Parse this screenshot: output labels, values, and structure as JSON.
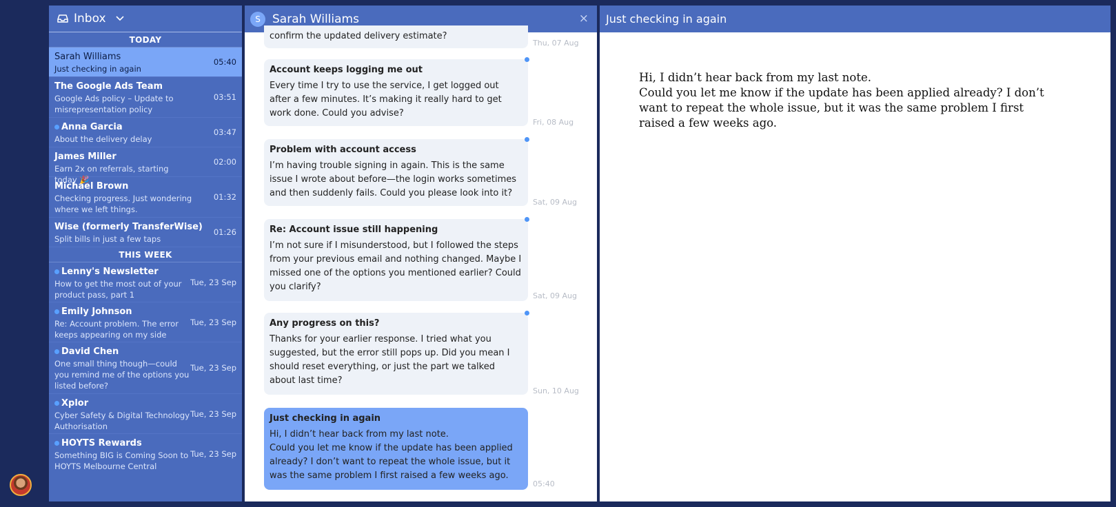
{
  "inbox": {
    "title": "Inbox",
    "sections": {
      "today": "TODAY",
      "this_week": "THIS WEEK"
    },
    "today": [
      {
        "from": "Sarah Williams",
        "preview": "Just checking in again",
        "time": "05:40",
        "unread": false,
        "selected": true
      },
      {
        "from": "The Google Ads Team",
        "preview": "Google Ads policy – Update to misrepresentation policy",
        "time": "03:51",
        "unread": false
      },
      {
        "from": "Anna Garcia",
        "preview": "About the delivery delay",
        "time": "03:47",
        "unread": true
      },
      {
        "from": "James Miller",
        "preview": "Earn 2x on referrals, starting today 🎉",
        "time": "02:00",
        "unread": false
      },
      {
        "from": "Michael Brown",
        "preview": "Checking progress. Just wondering where we left things.",
        "time": "01:32",
        "unread": false
      },
      {
        "from": "Wise (formerly TransferWise)",
        "preview": "Split bills in just a few taps",
        "time": "01:26",
        "unread": false
      }
    ],
    "this_week": [
      {
        "from": "Lenny's Newsletter",
        "preview": "How to get the most out of your product pass, part 1",
        "time": "Tue, 23 Sep",
        "unread": true
      },
      {
        "from": "Emily Johnson",
        "preview": "Re: Account problem. The error keeps appearing on my side",
        "time": "Tue, 23 Sep",
        "unread": true
      },
      {
        "from": "David Chen",
        "preview": "One small thing though—could you remind me of the options you listed before?",
        "time": "Tue, 23 Sep",
        "unread": true
      },
      {
        "from": "Xplor",
        "preview": "Cyber Safety & Digital Technology Authorisation",
        "time": "Tue, 23 Sep",
        "unread": true
      },
      {
        "from": "HOYTS Rewards",
        "preview": "Something BIG is Coming Soon to HOYTS Melbourne Central",
        "time": "Tue, 23 Sep",
        "unread": true
      }
    ]
  },
  "conversation": {
    "avatar_initial": "S",
    "name": "Sarah Williams",
    "close_glyph": "×",
    "partial_message": {
      "body": "confirm the updated delivery estimate?",
      "stamp": "Thu, 07 Aug"
    },
    "messages": [
      {
        "subject": "Account keeps logging me out",
        "body": "Every time I try to use the service, I get logged out after a few minutes. It’s making it really hard to get work done. Could you advise?",
        "stamp": "Fri, 08 Aug"
      },
      {
        "subject": "Problem with account access",
        "body": "I’m having trouble signing in again. This is the same issue I wrote about before—the login works sometimes and then suddenly fails. Could you please look into it?",
        "stamp": "Sat, 09 Aug"
      },
      {
        "subject": "Re: Account issue still happening",
        "body": "I’m not sure if I misunderstood, but I followed the steps from your previous email and nothing changed. Maybe I missed one of the options you mentioned earlier? Could you clarify?",
        "stamp": "Sat, 09 Aug"
      },
      {
        "subject": "Any progress on this?",
        "body": "Thanks for your earlier response. I tried what you suggested, but the error still pops up. Did you mean I should reset everything, or just the part we talked about last time?",
        "stamp": "Sun, 10 Aug"
      },
      {
        "subject": "Just checking in again",
        "body_line1": "Hi, I didn’t hear back from my last note.",
        "body_line2": "Could you let me know if the update has been applied already? I don’t want to repeat the whole issue, but it was the same problem I first raised a few weeks ago.",
        "stamp": "05:40"
      }
    ]
  },
  "reader": {
    "title": "Just checking in again",
    "line1": "Hi, I didn’t hear back from my last note.",
    "line2": "Could you let me know if the update has been applied already? I don’t want to repeat the whole issue, but it was the same problem I first raised a few weeks ago."
  },
  "colors": {
    "background": "#1b2a5c",
    "panel_header": "#4a6bbd",
    "selected": "#7aa6f7",
    "unread_dot": "#59a0ff"
  }
}
